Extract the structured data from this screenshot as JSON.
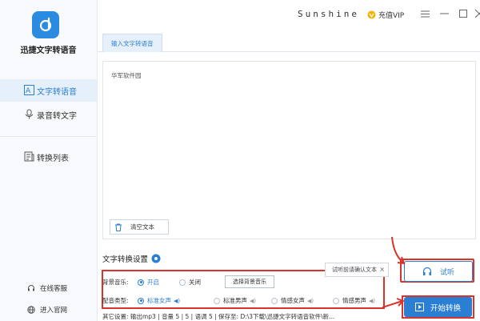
{
  "app": {
    "title": "迅捷文字转语音"
  },
  "sidebar": {
    "items": [
      {
        "label": "文字转语音",
        "active": true
      },
      {
        "label": "录音转文字",
        "active": false
      },
      {
        "label": "转换列表",
        "active": false
      }
    ],
    "online_service": "在线客服",
    "official_site": "进入官网"
  },
  "titlebar": {
    "user": "Sunshine",
    "vip_label": "充值VIP"
  },
  "tab": {
    "label": "输入文字转语音"
  },
  "editor": {
    "text": "华军软件园",
    "clear_label": "清空文本"
  },
  "settings": {
    "title": "文字转换设置",
    "bg_music_label": "背景音乐:",
    "bg_on": "开启",
    "bg_off": "关闭",
    "bg_select_label": "选择背景音乐",
    "voice_label": "配音类型:",
    "voices": [
      "标准女声",
      "标准男声",
      "情感女声",
      "情感男声"
    ],
    "other_label": "其它设置:",
    "output_format": "输出mp3",
    "volume": "音量 5",
    "speed_sep": "5",
    "pitch": "语调 5",
    "save_to": "保存至: D:\\3下载\\迅捷文字转语音软件\\新..."
  },
  "tooltip": {
    "text": "试听前请确认文本",
    "close": "×"
  },
  "actions": {
    "try_label": "试听",
    "start_label": "开始转换"
  },
  "colors": {
    "accent": "#2a7fd4",
    "highlight": "#d9342b"
  }
}
